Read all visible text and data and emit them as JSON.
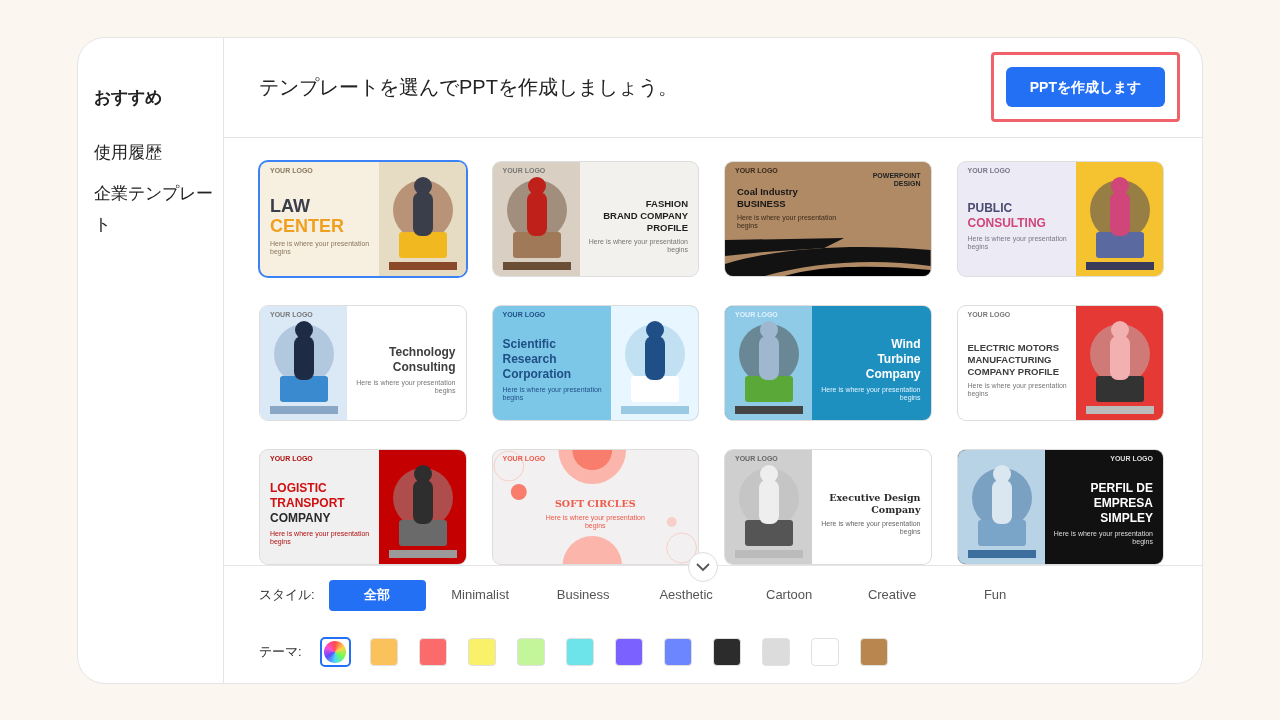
{
  "sidebar": {
    "items": [
      {
        "label": "おすすめ",
        "selected": true
      },
      {
        "label": "使用履歴",
        "selected": false
      },
      {
        "label": "企業テンプレート",
        "selected": false
      }
    ]
  },
  "header": {
    "title": "テンプレートを選んでPPTを作成しましょう。",
    "button": {
      "label": "PPTを作成します",
      "highlighted": true
    }
  },
  "templates": [
    {
      "selected": true,
      "logo": "YOUR LOGO",
      "title": [
        "LAW",
        "CENTER"
      ],
      "subtitle": "Here is where your presentation begins"
    },
    {
      "selected": false,
      "logo": "YOUR LOGO",
      "title": [
        "FASHION",
        "BRAND COMPANY",
        "PROFILE"
      ],
      "subtitle": "Here is where your presentation begins"
    },
    {
      "selected": false,
      "logo": "YOUR LOGO",
      "tag": "POWERPOINT DESIGN",
      "title": [
        "Coal Industry",
        "BUSINESS"
      ],
      "subtitle": "Here is where your presentation begins"
    },
    {
      "selected": false,
      "logo": "YOUR LOGO",
      "title": [
        "PUBLIC",
        "CONSULTING"
      ],
      "subtitle": "Here is where your presentation begins"
    },
    {
      "selected": false,
      "logo": "YOUR LOGO",
      "title": [
        "Technology",
        "Consulting"
      ],
      "subtitle": "Here is where your presentation begins"
    },
    {
      "selected": false,
      "logo": "YOUR LOGO",
      "title": [
        "Scientific",
        "Research",
        "Corporation"
      ],
      "subtitle": "Here is where your presentation begins"
    },
    {
      "selected": false,
      "logo": "YOUR LOGO",
      "title": [
        "Wind",
        "Turbine",
        "Company"
      ],
      "subtitle": "Here is where your presentation begins"
    },
    {
      "selected": false,
      "logo": "YOUR LOGO",
      "title": [
        "ELECTRIC MOTORS",
        "MANUFACTURING",
        "COMPANY PROFILE"
      ],
      "subtitle": "Here is where your presentation begins"
    },
    {
      "selected": false,
      "logo": "YOUR LOGO",
      "title": [
        "LOGISTIC",
        "TRANSPORT",
        "COMPANY"
      ],
      "subtitle": "Here is where your presentation begins"
    },
    {
      "selected": false,
      "logo": "YOUR LOGO",
      "title": [
        "SOFT CIRCLES"
      ],
      "subtitle": "Here is where your presentation begins"
    },
    {
      "selected": false,
      "logo": "YOUR LOGO",
      "title": [
        "Executive Design",
        "Company"
      ],
      "subtitle": "Here is where your presentation begins"
    },
    {
      "selected": false,
      "logo": "YOUR LOGO",
      "title": [
        "PERFIL DE",
        "EMPRESA",
        "SIMPLEY"
      ],
      "subtitle": "Here is where your presentation begins"
    }
  ],
  "styles": {
    "label": "スタイル:",
    "options": [
      {
        "label": "全部",
        "selected": true
      },
      {
        "label": "Minimalist",
        "selected": false
      },
      {
        "label": "Business",
        "selected": false
      },
      {
        "label": "Aesthetic",
        "selected": false
      },
      {
        "label": "Cartoon",
        "selected": false
      },
      {
        "label": "Creative",
        "selected": false
      },
      {
        "label": "Fun",
        "selected": false
      }
    ]
  },
  "themes": {
    "label": "テーマ:",
    "swatches": [
      {
        "kind": "rainbow",
        "selected": true
      },
      {
        "kind": "solid",
        "color": "#fbc25c",
        "selected": false
      },
      {
        "kind": "solid",
        "color": "#fb6b6b",
        "selected": false
      },
      {
        "kind": "solid",
        "color": "#f9f16a",
        "selected": false
      },
      {
        "kind": "solid",
        "color": "#c3f59a",
        "selected": false
      },
      {
        "kind": "solid",
        "color": "#6de3ea",
        "selected": false
      },
      {
        "kind": "solid",
        "color": "#7b61ff",
        "selected": false
      },
      {
        "kind": "solid",
        "color": "#6b86ff",
        "selected": false
      },
      {
        "kind": "solid",
        "color": "#2c2c2c",
        "selected": false
      },
      {
        "kind": "solid",
        "color": "#dcdcdc",
        "selected": false
      },
      {
        "kind": "solid",
        "color": "#ffffff",
        "selected": false
      },
      {
        "kind": "solid",
        "color": "#b98650",
        "selected": false
      }
    ]
  }
}
